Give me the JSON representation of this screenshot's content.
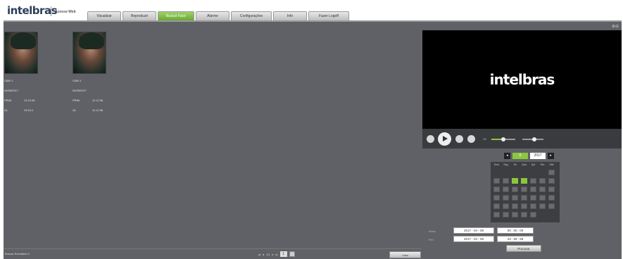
{
  "header": {
    "brand": "intelbras",
    "subtitle": "Acesso Web",
    "tabs": [
      {
        "label": "Visualizar",
        "active": false
      },
      {
        "label": "Reproduzir",
        "active": false
      },
      {
        "label": "Buscar Face",
        "active": true
      },
      {
        "label": "Alarme",
        "active": false
      },
      {
        "label": "Configurações",
        "active": false
      },
      {
        "label": "Info",
        "active": false
      },
      {
        "label": "Fazer Logoff",
        "active": false
      }
    ]
  },
  "faces": [
    {
      "channel": "CAM 1",
      "date": "04/06/2017",
      "start_label": "PRIM",
      "start_value": "12:12:36",
      "end_label": "ÚL",
      "end_value": "15:10:1"
    },
    {
      "channel": "CAM 1",
      "date": "04/06/2017",
      "start_label": "PRIM",
      "start_value": "11:12:36",
      "end_label": "ÚL",
      "end_value": "11:12:36"
    }
  ],
  "footer": {
    "status": "Buscar Resultado:2",
    "pager_text": "1/1",
    "page_number": "1",
    "list_button": "Lista"
  },
  "player": {
    "logo": "intelbras",
    "zoom_icons": "⊕⊖",
    "speed": "1X"
  },
  "calendar": {
    "month": "6",
    "year": "2017",
    "weekdays": [
      "Dom",
      "Seg",
      "Ter",
      "Qua",
      "Qui",
      "Sex",
      "Sáb"
    ],
    "highlighted_days": [
      4,
      5
    ]
  },
  "time_range": {
    "start_label": "Início",
    "start_date": "2017 - 04 - 06",
    "start_time": "00 : 00 : 00",
    "end_label": "Fim",
    "end_date": "2017 - 04 - 06",
    "end_time": "23 : 59 : 59",
    "search_button": "Procurar"
  },
  "colors": {
    "accent": "#8cc63f",
    "panel": "#5f6166",
    "video_bg": "#000000"
  }
}
